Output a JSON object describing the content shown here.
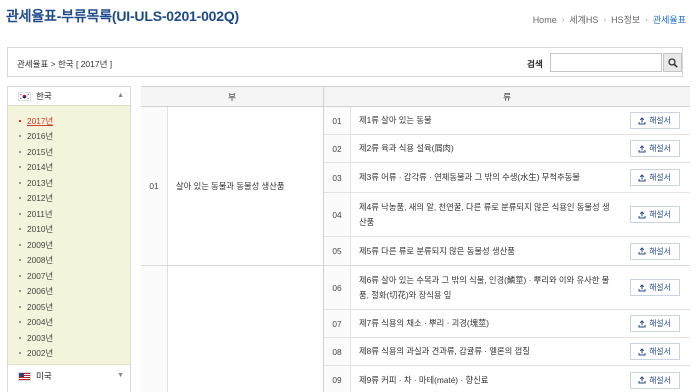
{
  "page": {
    "title": "관세율표-부류목록(UI-ULS-0201-002Q)"
  },
  "breadcrumb": [
    "Home",
    "세계HS",
    "HS정보",
    "관세율표"
  ],
  "toolbar": {
    "path_text": "관세율표 > 한국 [ 2017년 ]",
    "search_label": "검색",
    "search_value": "",
    "search_icon": "search-icon"
  },
  "sidebar": {
    "countries": [
      {
        "label": "한국",
        "flag_icon": "flag-kr-icon"
      },
      {
        "label": "미국",
        "flag_icon": "flag-us-icon"
      }
    ],
    "years": [
      "2017년",
      "2016년",
      "2015년",
      "2014년",
      "2013년",
      "2012년",
      "2011년",
      "2010년",
      "2009년",
      "2008년",
      "2007년",
      "2006년",
      "2005년",
      "2004년",
      "2003년",
      "2002년"
    ],
    "selected_year": "2017년"
  },
  "table": {
    "headers": {
      "bu": "부",
      "ryu": "류"
    },
    "button_label": "해설서",
    "sections": [
      {
        "num": "01",
        "name": "살아 있는 동물과 동물성 생산품",
        "chapters": [
          {
            "num": "01",
            "name": "제1류 살아 있는 동물"
          },
          {
            "num": "02",
            "name": "제2류 육과 식용 설육(屑肉)"
          },
          {
            "num": "03",
            "name": "제3류 어류 · 갑각류 · 연체동물과 그 밖의 수생(水生) 무척추동물"
          },
          {
            "num": "04",
            "name": "제4류 낙농품, 새의 알, 천연꿀, 다른 류로 분류되지 않은 식용인 동물성 생산품"
          },
          {
            "num": "05",
            "name": "제5류 다른 류로 분류되지 않은 동물성 생산품"
          }
        ]
      },
      {
        "num": "",
        "name": "",
        "chapters": [
          {
            "num": "06",
            "name": "제6류 살아 있는 수목과 그 밖의 식물, 인경(鱗莖) · 뿌리와 이와 유사한 물품, 절화(切花)와 장식용 잎"
          },
          {
            "num": "07",
            "name": "제7류 식용의 채소 · 뿌리 · 괴경(塊莖)"
          },
          {
            "num": "08",
            "name": "제8류 식용의 과실과 견과류, 감귤류 · 멜론의 껍질"
          },
          {
            "num": "09",
            "name": "제9류 커피 · 차 · 마테(maté) · 향신료"
          }
        ]
      }
    ]
  }
}
